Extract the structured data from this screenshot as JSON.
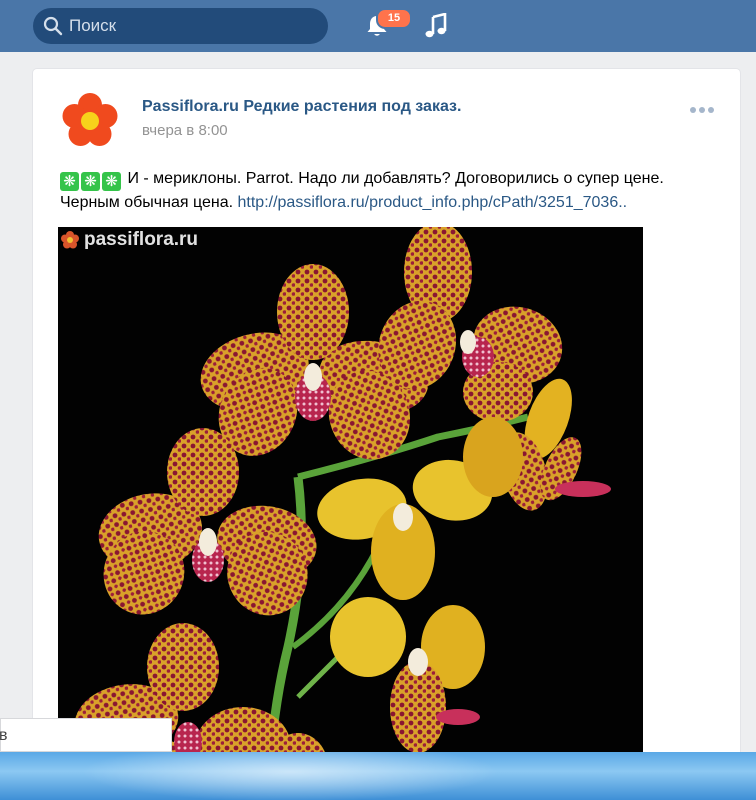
{
  "header": {
    "search_placeholder": "Поиск",
    "notifications_count": "15",
    "icons": [
      "search-icon",
      "bell-icon",
      "music-icon"
    ],
    "bg_color": "#4a76a8"
  },
  "post": {
    "author": "Passiflora.ru Редкие растения под заказ.",
    "time": "вчера в 8:00",
    "text_line1": "И - мериклоны. Parrot. Надо ли добавлять? Договорились о супер цене.",
    "text_line2": "Черным обычная цена.",
    "link": "http://passiflora.ru/product_info.php/cPath/3251_7036..",
    "emoji_symbol": "❋",
    "photo_watermark": "passiflora.ru",
    "link_color": "#2a5885"
  },
  "tooltip": {
    "text": "в"
  }
}
